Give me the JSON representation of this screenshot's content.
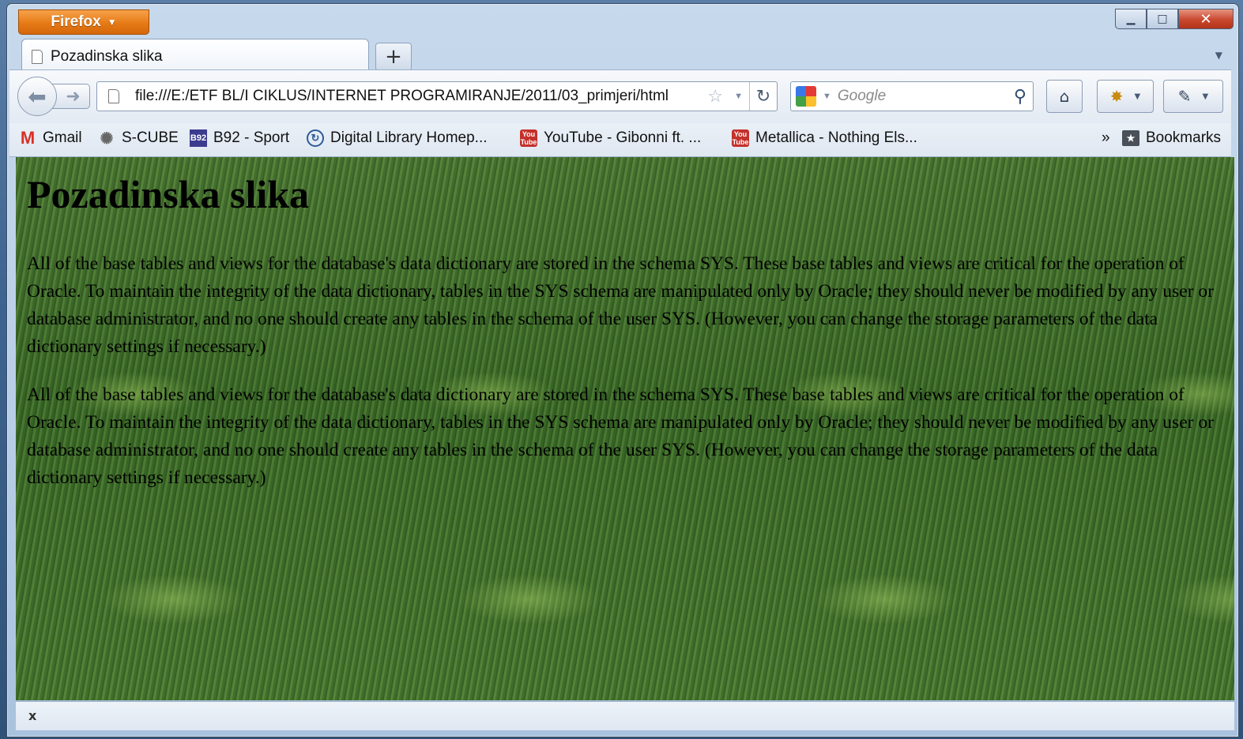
{
  "browser": {
    "app_button_label": "Firefox",
    "window_controls": {
      "minimize": "▁",
      "maximize": "□",
      "close": "✕"
    }
  },
  "tabs": [
    {
      "label": "Pozadinska slika",
      "active": true
    }
  ],
  "new_tab_label": "+",
  "navigation": {
    "url": "file:///E:/ETF BL/I CIKLUS/INTERNET PROGRAMIRANJE/2011/03_primjeri/html",
    "search_placeholder": "Google"
  },
  "bookmarks": {
    "items": [
      {
        "label": "Gmail",
        "icon": "gmail-icon"
      },
      {
        "label": "S-CUBE",
        "icon": "scube-icon"
      },
      {
        "label": "B92 - Sport",
        "icon": "b92-icon"
      },
      {
        "label": "Digital Library Homep...",
        "icon": "digital-library-icon"
      },
      {
        "label": "YouTube - Gibonni ft. ...",
        "icon": "youtube-icon"
      },
      {
        "label": "Metallica - Nothing Els...",
        "icon": "youtube-icon"
      }
    ],
    "overflow": "»",
    "menu_label": "Bookmarks"
  },
  "page": {
    "heading": "Pozadinska slika",
    "paragraphs": [
      "All of the base tables and views for the database's data dictionary are stored in the schema SYS. These base tables and views are critical for the operation of Oracle. To maintain the integrity of the data dictionary, tables in the SYS schema are manipulated only by Oracle; they should never be modified by any user or database administrator, and no one should create any tables in the schema of the user SYS. (However, you can change the storage parameters of the data dictionary settings if necessary.)",
      "All of the base tables and views for the database's data dictionary are stored in the schema SYS. These base tables and views are critical for the operation of Oracle. To maintain the integrity of the data dictionary, tables in the SYS schema are manipulated only by Oracle; they should never be modified by any user or database administrator, and no one should create any tables in the schema of the user SYS. (However, you can change the storage parameters of the data dictionary settings if necessary.)"
    ]
  },
  "status_bar": {
    "close_label": "x"
  },
  "colors": {
    "firefox_orange": "#e67a16",
    "close_red": "#c9482e"
  }
}
